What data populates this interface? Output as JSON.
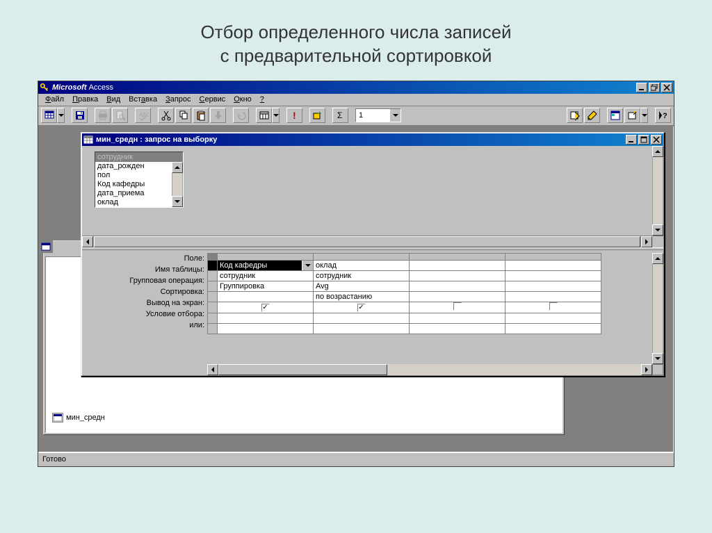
{
  "slide": {
    "title_line1": "Отбор определенного числа записей",
    "title_line2": "с предварительной сортировкой"
  },
  "app": {
    "title_brand": "Microsoft",
    "title_product": "Access",
    "menu": [
      "Файл",
      "Правка",
      "Вид",
      "Вставка",
      "Запрос",
      "Сервис",
      "Окно",
      "?"
    ],
    "combo_value": "1",
    "status": "Готово"
  },
  "db_window": {
    "item_label": "мин_средн"
  },
  "query_window": {
    "title": "мин_средн : запрос на выборку",
    "field_list": {
      "title": "сотрудник",
      "fields": [
        "дата_рожден",
        "пол",
        "Код кафедры",
        "дата_приема",
        "оклад"
      ]
    },
    "qbe": {
      "row_labels": [
        "Поле:",
        "Имя таблицы:",
        "Групповая операция:",
        "Сортировка:",
        "Вывод на экран:",
        "Условие отбора:",
        "или:"
      ],
      "columns": [
        {
          "field": "Код кафедры",
          "table": "сотрудник",
          "groupop": "Группировка",
          "sort": "",
          "show": true
        },
        {
          "field": "оклад",
          "table": "сотрудник",
          "groupop": "Avg",
          "sort": "по возрастанию",
          "show": true
        },
        {
          "field": "",
          "table": "",
          "groupop": "",
          "sort": "",
          "show": false
        },
        {
          "field": "",
          "table": "",
          "groupop": "",
          "sort": "",
          "show": false
        }
      ]
    }
  }
}
